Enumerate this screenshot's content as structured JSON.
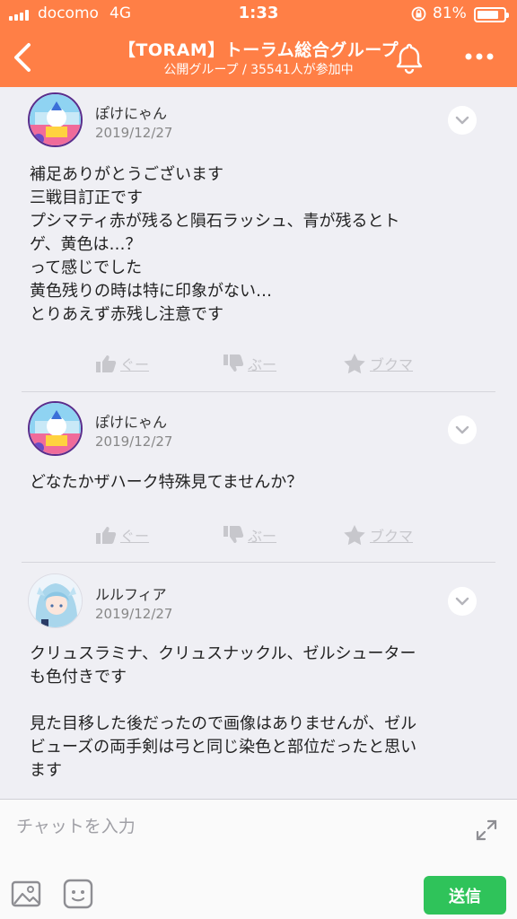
{
  "status_bar": {
    "carrier": "docomo",
    "network": "4G",
    "time": "1:33",
    "battery": "81%",
    "battery_level": 0.81
  },
  "header": {
    "title": "【TORAM】トーラム総合グループ",
    "subtitle": "公開グループ / 35541人が参加中",
    "back_icon": "chevron-left-icon",
    "bell_icon": "bell-icon",
    "more_icon": "more-dots-icon"
  },
  "posts": [
    {
      "author": "ぽけにゃん",
      "date": "2019/12/27",
      "body": "補足ありがとうございます\n三戦目訂正です\nプシマティ赤が残ると隕石ラッシュ、青が残るとト\nゲ、黄色は…？\nって感じでした\n黄色残りの時は特に印象がない…\nとりあえず赤残し注意です",
      "like_label": "ぐー",
      "dislike_label": "ぶー",
      "bookmark_label": "ブクマ"
    },
    {
      "author": "ぽけにゃん",
      "date": "2019/12/27",
      "body": "どなたかザハーク特殊見てませんか？",
      "like_label": "ぐー",
      "dislike_label": "ぶー",
      "bookmark_label": "ブクマ"
    },
    {
      "author": "ルルフィア",
      "date": "2019/12/27",
      "body": "クリュスラミナ、クリュスナックル、ゼルシューター\nも色付きです\n\n見た目移した後だったので画像はありませんが、ゼル\nビューズの両手剣は弓と同じ染色と部位だったと思い\nます"
    }
  ],
  "composer": {
    "placeholder": "チャットを入力",
    "send_label": "送信"
  },
  "colors": {
    "header_bg": "#ff7f46",
    "send_bg": "#2fc35a",
    "feed_bg": "#efeff4"
  }
}
